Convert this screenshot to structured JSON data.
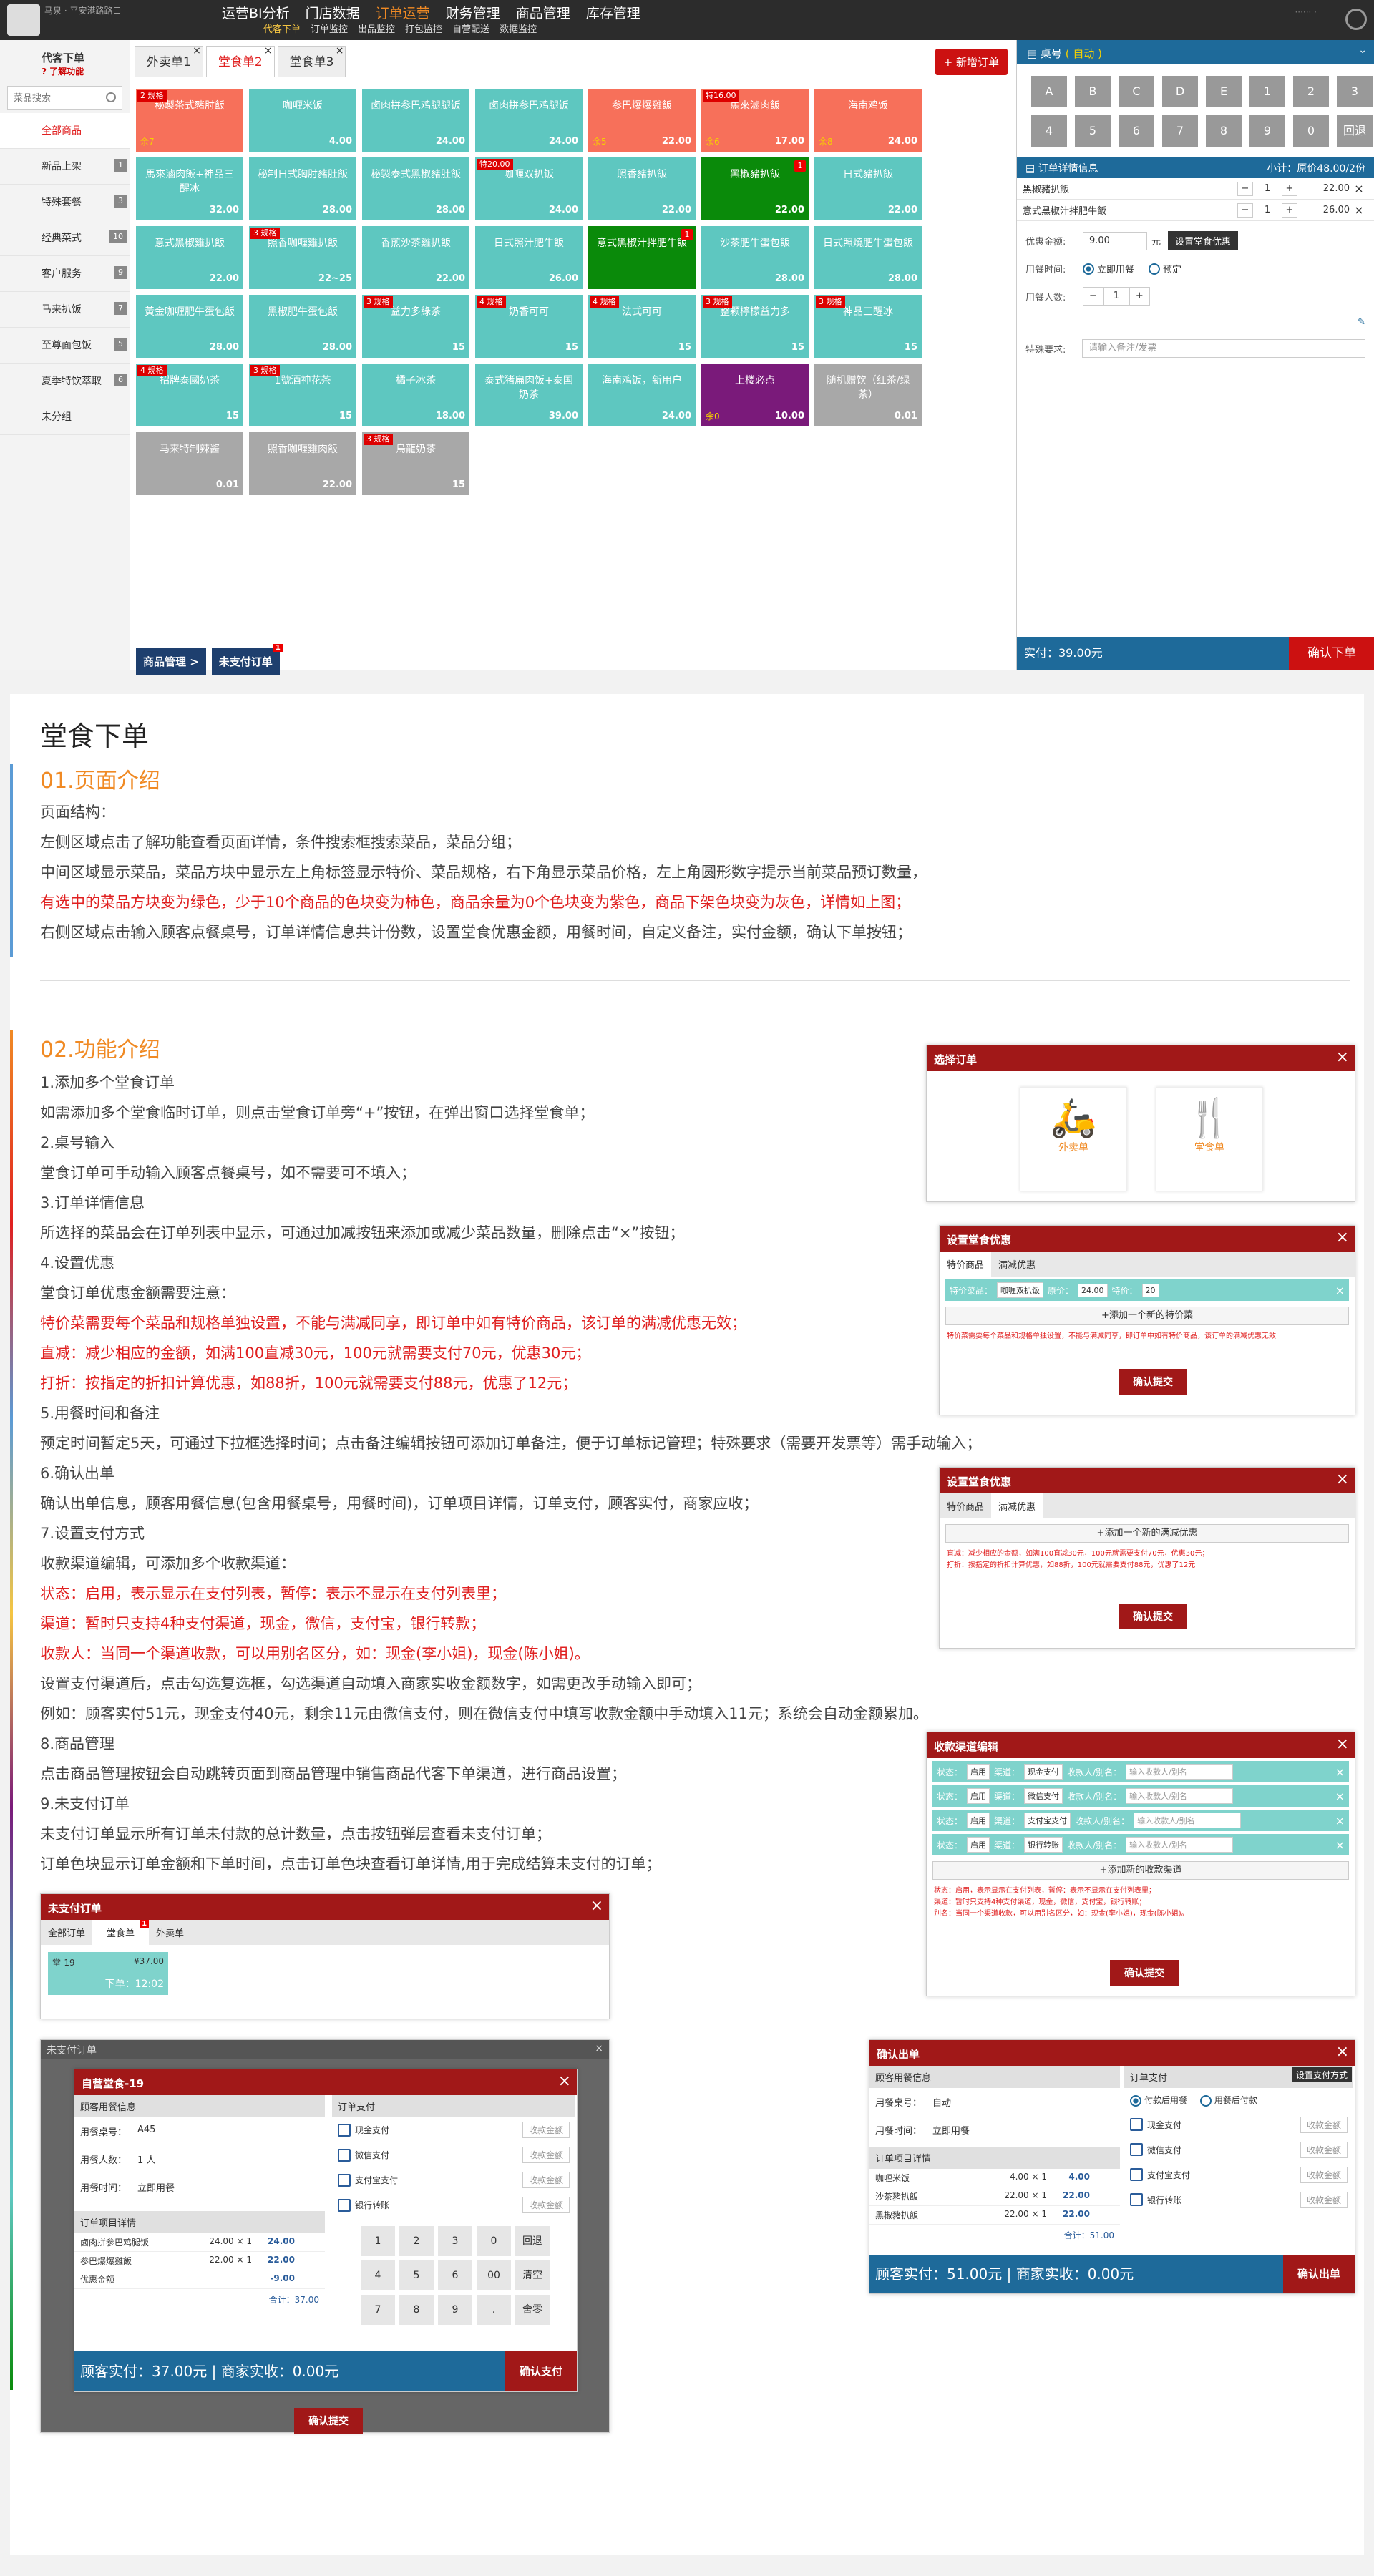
{
  "topnav": {
    "user": "马泉 · 平安港路路口",
    "menu": [
      "运营BI分析",
      "门店数据",
      "订单运营",
      "财务管理",
      "商品管理",
      "库存管理"
    ],
    "active_menu": "订单运营",
    "submenu": [
      "代客下单",
      "订单监控",
      "出品监控",
      "打包监控",
      "自营配送",
      "数据监控"
    ],
    "active_sub": "代客下单",
    "right_info": "······ ·"
  },
  "sidebar": {
    "title": "代客下单",
    "help": "了解功能",
    "search_placeholder": "菜品搜索",
    "categories": [
      {
        "label": "全部商品",
        "count": ""
      },
      {
        "label": "新品上架",
        "count": "1"
      },
      {
        "label": "特殊套餐",
        "count": "3"
      },
      {
        "label": "经典菜式",
        "count": "10"
      },
      {
        "label": "客户服务",
        "count": "9"
      },
      {
        "label": "马来扒饭",
        "count": "7"
      },
      {
        "label": "至尊面包饭",
        "count": "5"
      },
      {
        "label": "夏季特饮萃取",
        "count": "6"
      },
      {
        "label": "未分组",
        "count": ""
      }
    ]
  },
  "tabs": [
    {
      "label": "外卖单1",
      "active": false
    },
    {
      "label": "堂食单2",
      "active": true
    },
    {
      "label": "堂食单3",
      "active": false
    }
  ],
  "new_order": "+ 新增订单",
  "dishes": [
    {
      "name": "秘製茶式豬肘飯",
      "price": "",
      "qty": "余7",
      "spec": "2 规格",
      "badge": "",
      "color": "persimmon"
    },
    {
      "name": "咖喱米饭",
      "price": "4.00",
      "qty": "",
      "spec": "",
      "badge": "",
      "color": "teal"
    },
    {
      "name": "卤肉拼参巴鸡腿腿饭",
      "price": "24.00",
      "qty": "",
      "spec": "",
      "badge": "",
      "color": "teal"
    },
    {
      "name": "卤肉拼参巴鸡腿饭",
      "price": "24.00",
      "qty": "",
      "spec": "",
      "badge": "",
      "color": "teal"
    },
    {
      "name": "参巴爆爆雞飯",
      "price": "22.00",
      "qty": "余5",
      "spec": "",
      "badge": "",
      "color": "persimmon"
    },
    {
      "name": "馬來滷肉飯",
      "price": "17.00",
      "qty": "余6",
      "spec": "特16.00",
      "badge": "",
      "color": "persimmon"
    },
    {
      "name": "海南鸡饭",
      "price": "24.00",
      "qty": "余8",
      "spec": "",
      "badge": "",
      "color": "persimmon"
    },
    {
      "name": "馬來滷肉飯+神品三醒冰",
      "price": "32.00",
      "qty": "",
      "spec": "",
      "badge": "",
      "color": "teal"
    },
    {
      "name": "秘制日式胸肘豬肚飯",
      "price": "28.00",
      "qty": "",
      "spec": "",
      "badge": "",
      "color": "teal"
    },
    {
      "name": "秘製泰式黑椒豬肚飯",
      "price": "28.00",
      "qty": "",
      "spec": "",
      "badge": "",
      "color": "teal"
    },
    {
      "name": "咖喱双扒饭",
      "price": "24.00",
      "qty": "",
      "spec": "特20.00",
      "badge": "",
      "color": "teal"
    },
    {
      "name": "照香豬扒飯",
      "price": "22.00",
      "qty": "",
      "spec": "",
      "badge": "",
      "color": "teal"
    },
    {
      "name": "黑椒豬扒飯",
      "price": "22.00",
      "qty": "",
      "spec": "",
      "badge": "1",
      "color": "green"
    },
    {
      "name": "日式豬扒飯",
      "price": "22.00",
      "qty": "",
      "spec": "",
      "badge": "",
      "color": "teal"
    },
    {
      "name": "意式黑椒雞扒飯",
      "price": "22.00",
      "qty": "",
      "spec": "",
      "badge": "",
      "color": "teal"
    },
    {
      "name": "照香咖喱雞扒飯",
      "price": "22~25",
      "qty": "",
      "spec": "3 规格",
      "badge": "",
      "color": "teal"
    },
    {
      "name": "香煎沙茶雞扒飯",
      "price": "22.00",
      "qty": "",
      "spec": "",
      "badge": "",
      "color": "teal"
    },
    {
      "name": "日式照汁肥牛飯",
      "price": "26.00",
      "qty": "",
      "spec": "",
      "badge": "",
      "color": "teal"
    },
    {
      "name": "意式黑椒汁拌肥牛飯",
      "price": "",
      "qty": "",
      "spec": "",
      "badge": "1",
      "color": "green"
    },
    {
      "name": "沙茶肥牛蛋包飯",
      "price": "28.00",
      "qty": "",
      "spec": "",
      "badge": "",
      "color": "teal"
    },
    {
      "name": "日式照燒肥牛蛋包飯",
      "price": "28.00",
      "qty": "",
      "spec": "",
      "badge": "",
      "color": "teal"
    },
    {
      "name": "黃金咖喱肥牛蛋包飯",
      "price": "28.00",
      "qty": "",
      "spec": "",
      "badge": "",
      "color": "teal"
    },
    {
      "name": "黑椒肥牛蛋包飯",
      "price": "28.00",
      "qty": "",
      "spec": "",
      "badge": "",
      "color": "teal"
    },
    {
      "name": "益力多綠茶",
      "price": "15",
      "qty": "",
      "spec": "3 规格",
      "badge": "",
      "color": "teal"
    },
    {
      "name": "奶香可可",
      "price": "15",
      "qty": "",
      "spec": "4 规格",
      "badge": "",
      "color": "teal"
    },
    {
      "name": "法式可可",
      "price": "15",
      "qty": "",
      "spec": "4 规格",
      "badge": "",
      "color": "teal"
    },
    {
      "name": "整颗檸檬益力多",
      "price": "15",
      "qty": "",
      "spec": "3 规格",
      "badge": "",
      "color": "teal"
    },
    {
      "name": "神品三醒冰",
      "price": "15",
      "qty": "",
      "spec": "3 规格",
      "badge": "",
      "color": "teal"
    },
    {
      "name": "招牌泰國奶茶",
      "price": "15",
      "qty": "",
      "spec": "4 规格",
      "badge": "",
      "color": "teal"
    },
    {
      "name": "1號酒神花茶",
      "price": "15",
      "qty": "",
      "spec": "3 规格",
      "badge": "",
      "color": "teal"
    },
    {
      "name": "橘子冰茶",
      "price": "18.00",
      "qty": "",
      "spec": "",
      "badge": "",
      "color": "teal"
    },
    {
      "name": "泰式猪扁肉饭+泰国奶茶",
      "price": "39.00",
      "qty": "",
      "spec": "",
      "badge": "",
      "color": "teal"
    },
    {
      "name": "海南鸡饭，新用户",
      "price": "24.00",
      "qty": "",
      "spec": "",
      "badge": "",
      "color": "teal"
    },
    {
      "name": "上楼必点",
      "price": "10.00",
      "qty": "余0",
      "spec": "",
      "badge": "",
      "color": "purple"
    },
    {
      "name": "随机赠饮（红茶/绿茶）",
      "price": "0.01",
      "qty": "",
      "spec": "",
      "badge": "",
      "color": "grey"
    },
    {
      "name": "马来特制辣酱",
      "price": "0.01",
      "qty": "",
      "spec": "",
      "badge": "",
      "color": "grey"
    },
    {
      "name": "照香咖喱雞肉飯",
      "price": "22.00",
      "qty": "",
      "spec": "",
      "badge": "",
      "color": "grey"
    },
    {
      "name": "烏龍奶茶",
      "price": "15",
      "qty": "",
      "spec": "3 规格",
      "badge": "",
      "color": "grey"
    }
  ],
  "bottom": {
    "manage": "商品管理 >",
    "unpaid": "未支付订单",
    "unpaid_count": "1"
  },
  "right": {
    "table_label": "桌号",
    "table_hint": "( 自动 )",
    "keys": [
      "A",
      "B",
      "C",
      "D",
      "E",
      "1",
      "2",
      "3",
      "4",
      "5",
      "6",
      "7",
      "8",
      "9",
      "0",
      "回退"
    ],
    "order_title": "订单详情信息",
    "subtotal": "小计：原价48.00/2份",
    "items": [
      {
        "name": "黑椒豬扒飯",
        "qty": "1",
        "price": "22.00"
      },
      {
        "name": "意式黑椒汁拌肥牛飯",
        "qty": "1",
        "price": "26.00"
      }
    ],
    "discount_label": "优惠金额:",
    "discount_value": "9.00",
    "discount_unit": "元",
    "discount_btn": "设置堂食优惠",
    "time_label": "用餐时间:",
    "time_now": "立即用餐",
    "time_book": "预定",
    "people_label": "用餐人数:",
    "people": "1",
    "remark_label": "特殊要求:",
    "remark_placeholder": "请输入备注/发票",
    "paid": "实付：39.00元",
    "confirm": "确认下单"
  },
  "doc": {
    "title": "堂食下单",
    "s1": "01.页面介绍",
    "s1_lines": [
      "页面结构：",
      "左侧区域点击了解功能查看页面详情，条件搜索框搜索菜品，菜品分组；",
      "中间区域显示菜品，菜品方块中显示左上角标签显示特价、菜品规格，右下角显示菜品价格，左上角圆形数字提示当前菜品预订数量，",
      "有选中的菜品方块变为绿色，少于10个商品的色块变为柿色，商品余量为0个色块变为紫色，商品下架色块变为灰色，详情如上图；",
      "右侧区域点击输入顾客点餐桌号，订单详情信息共计份数，设置堂食优惠金额，用餐时间，自定义备注，实付金额，确认下单按钮；"
    ],
    "s2": "02.功能介绍",
    "s2_lines": [
      "1.添加多个堂食订单",
      "如需添加多个堂食临时订单，则点击堂食订单旁“+”按钮，在弹出窗口选择堂食单；",
      "2.桌号输入",
      "堂食订单可手动输入顾客点餐桌号，如不需要可不填入；",
      "3.订单详情信息",
      "所选择的菜品会在订单列表中显示，可通过加减按钮来添加或减少菜品数量，删除点击“×”按钮；",
      "4.设置优惠",
      "堂食订单优惠金额需要注意：",
      "特价菜需要每个菜品和规格单独设置，不能与满减同享，即订单中如有特价商品，该订单的满减优惠无效；",
      "直减：减少相应的金额，如满100直减30元，100元就需要支付70元，优惠30元；",
      "打折：按指定的折扣计算优惠，如88折，100元就需要支付88元，优惠了12元；",
      "5.用餐时间和备注",
      "预定时间暂定5天，可通过下拉框选择时间；点击备注编辑按钮可添加订单备注，便于订单标记管理；特殊要求（需要开发票等）需手动输入；",
      "6.确认出单",
      "确认出单信息，顾客用餐信息(包含用餐桌号，用餐时间)，订单项目详情，订单支付，顾客实付，商家应收；",
      "7.设置支付方式",
      "收款渠道编辑，可添加多个收款渠道：",
      "状态：启用，表示显示在支付列表，暂停：表示不显示在支付列表里；",
      "渠道：暂时只支持4种支付渠道，现金，微信，支付宝，银行转款；",
      "收款人：当同一个渠道收款，可以用别名区分，如：现金(李小姐)，现金(陈小姐)。",
      "设置支付渠道后，点击勾选复选框，勾选渠道自动填入商家实收金额数字，如需更改手动输入即可；",
      "例如：顾客实付51元，现金支付40元，剩余11元由微信支付，则在微信支付中填写收款金额中手动填入11元；系统会自动金额累加。",
      "8.商品管理",
      "点击商品管理按钮会自动跳转页面到商品管理中销售商品代客下单渠道，进行商品设置；",
      "9.未支付订单",
      "未支付订单显示所有订单未付款的总计数量，点击按钮弹层查看未支付订单；",
      "订单色块显示订单金额和下单时间，点击订单色块查看订单详情,用于完成结算未支付的订单；"
    ]
  },
  "m_select": {
    "title": "选择订单",
    "opt1": "外卖单",
    "opt2": "堂食单"
  },
  "m_disc1": {
    "title": "设置堂食优惠",
    "tabs": [
      "特价商品",
      "满减优惠"
    ],
    "row": [
      "特价菜品：",
      "咖喱双扒饭",
      "原价：",
      "24.00",
      "特价：",
      "20"
    ],
    "add": "+添加一个新的特价菜",
    "note": "特价菜需要每个菜品和规格单独设置，不能与满减同享，即订单中如有特价商品，该订单的满减优惠无效",
    "ok": "确认提交"
  },
  "m_disc2": {
    "title": "设置堂食优惠",
    "tabs": [
      "特价商品",
      "满减优惠"
    ],
    "add": "+添加一个新的满减优惠",
    "note1": "直减：减少相应的金额，如满100直减30元，100元就需要支付70元，优惠30元；",
    "note2": "打折：按指定的折扣计算优惠，如88折，100元就需要支付88元，优惠了12元",
    "ok": "确认提交"
  },
  "m_channel": {
    "title": "收款渠道编辑",
    "rows": [
      {
        "status": "启用",
        "channel": "现金支付"
      },
      {
        "status": "启用",
        "channel": "微信支付"
      },
      {
        "status": "启用",
        "channel": "支付宝支付"
      },
      {
        "status": "启用",
        "channel": "银行转账"
      }
    ],
    "status_label": "状态：",
    "channel_label": "渠道：",
    "payee_label": "收款人/别名：",
    "payee_ph": "输入收款人/别名",
    "add": "+添加新的收款渠道",
    "note1": "状态：启用，表示显示在支付列表，暂停：表示不显示在支付列表里；",
    "note2": "渠道：暂时只支持4种支付渠道，现金，微信，支付宝，银行转账；",
    "note3": "别名：当同一个渠道收款，可以用别名区分，如：现金(李小姐)，现金(陈小姐)。",
    "ok": "确认提交"
  },
  "m_unpaid": {
    "title": "未支付订单",
    "tabs": [
      "全部订单",
      "堂食单",
      "外卖单"
    ],
    "badge": "1",
    "card_name": "堂-19",
    "card_price": "¥37.00",
    "card_time": "下单：12:02"
  },
  "m_checkout": {
    "bg_title": "未支付订单",
    "title": "自营堂食-19",
    "info_head": "顾客用餐信息",
    "pay_head": "订单支付",
    "table": "用餐桌号：",
    "table_v": "A45",
    "people": "用餐人数：",
    "people_v": "1 人",
    "time": "用餐时间：",
    "time_v": "立即用餐",
    "pays": [
      "现金支付",
      "微信支付",
      "支付宝支付",
      "银行转账"
    ],
    "pay_ph": "收款金额",
    "detail_head": "订单项目详情",
    "items": [
      {
        "n": "卤肉拼参巴鸡腿饭",
        "p": "24.00 × 1",
        "t": "24.00"
      },
      {
        "n": "参巴爆爆雞飯",
        "p": "22.00 × 1",
        "t": "22.00"
      },
      {
        "n": "优惠金额",
        "p": "",
        "t": "-9.00"
      }
    ],
    "total": "合计：37.00",
    "keys": [
      "1",
      "2",
      "3",
      "0",
      "回退",
      "4",
      "5",
      "6",
      "00",
      "清空",
      "7",
      "8",
      "9",
      ".",
      "舍零"
    ],
    "foot": "顾客实付：37.00元 | 商家实收：0.00元",
    "confirm": "确认支付",
    "submit": "确认提交"
  },
  "m_confirm": {
    "title": "确认出单",
    "info_head": "顾客用餐信息",
    "pay_head": "订单支付",
    "set_pay": "设置支付方式",
    "table": "用餐桌号：",
    "table_v": "自动",
    "time": "用餐时间：",
    "time_v": "立即用餐",
    "r1": "付款后用餐",
    "r2": "用餐后付款",
    "pays": [
      "现金支付",
      "微信支付",
      "支付宝支付",
      "银行转账"
    ],
    "pay_ph": "收款金额",
    "detail_head": "订单项目详情",
    "items": [
      {
        "n": "咖喱米饭",
        "p": "4.00 × 1",
        "t": "4.00"
      },
      {
        "n": "沙茶豬扒飯",
        "p": "22.00 × 1",
        "t": "22.00"
      },
      {
        "n": "黑椒豬扒飯",
        "p": "22.00 × 1",
        "t": "22.00"
      }
    ],
    "total": "合计：51.00",
    "foot": "顾客实付：51.00元 | 商家实收：0.00元",
    "confirm": "确认出单"
  }
}
